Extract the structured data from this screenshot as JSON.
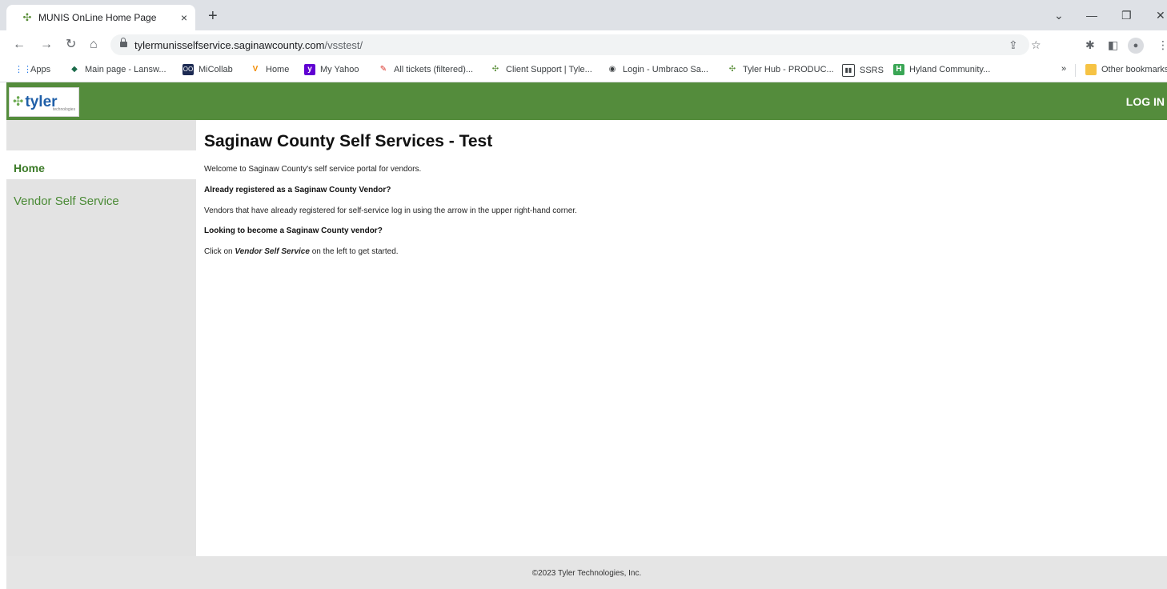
{
  "browser": {
    "tab_title": "MUNIS OnLine Home Page",
    "tab_close": "×",
    "new_tab": "+",
    "window": {
      "minimize": "—",
      "restore": "❐",
      "close": "✕",
      "dropdown": "⌄"
    },
    "url_host": "tylermunisselfservice.saginawcounty.com",
    "url_path": "/vsstest/",
    "nav": {
      "back": "←",
      "forward": "→",
      "reload": "↻",
      "home": "⌂"
    },
    "bookmarks": [
      {
        "label": "Apps",
        "icon": "apps-grid-icon"
      },
      {
        "label": "Main page - Lansw...",
        "icon": "lansweeper-icon"
      },
      {
        "label": "MiCollab",
        "icon": "micollab-icon"
      },
      {
        "label": "Home",
        "icon": "home-bookmark-icon"
      },
      {
        "label": "My Yahoo",
        "icon": "yahoo-icon"
      },
      {
        "label": "All tickets (filtered)...",
        "icon": "tickets-icon"
      },
      {
        "label": "Client Support | Tyle...",
        "icon": "tyler-icon"
      },
      {
        "label": "Login - Umbraco Sa...",
        "icon": "globe-icon"
      },
      {
        "label": "Tyler Hub - PRODUC...",
        "icon": "tyler-icon"
      },
      {
        "label": "SSRS",
        "icon": "ssrs-icon"
      },
      {
        "label": "Hyland Community...",
        "icon": "hyland-icon"
      }
    ],
    "more_bookmarks": "»",
    "other_bookmarks": "Other bookmarks"
  },
  "header": {
    "logo_text": "tyler",
    "logo_sub": "technologies",
    "login_label": "LOG IN"
  },
  "sidebar": {
    "items": [
      {
        "label": "Home",
        "active": true
      },
      {
        "label": "Vendor Self Service",
        "active": false
      }
    ]
  },
  "main": {
    "title": "Saginaw County Self Services - Test",
    "welcome": "Welcome to Saginaw County's self service portal for vendors.",
    "registered_heading": "Already registered as a Saginaw County Vendor?",
    "registered_text": "Vendors that have already registered for self-service log in using the arrow in the upper right-hand corner.",
    "become_heading": "Looking to become a Saginaw County vendor?",
    "click_prefix": "Click on ",
    "click_link": "Vendor Self Service",
    "click_suffix": " on the left to get started."
  },
  "footer": {
    "copyright": "©2023 Tyler Technologies, Inc."
  },
  "colors": {
    "header_green": "#548c3c",
    "nav_green": "#3b7a27",
    "sidebar_gray": "#e3e3e3"
  }
}
